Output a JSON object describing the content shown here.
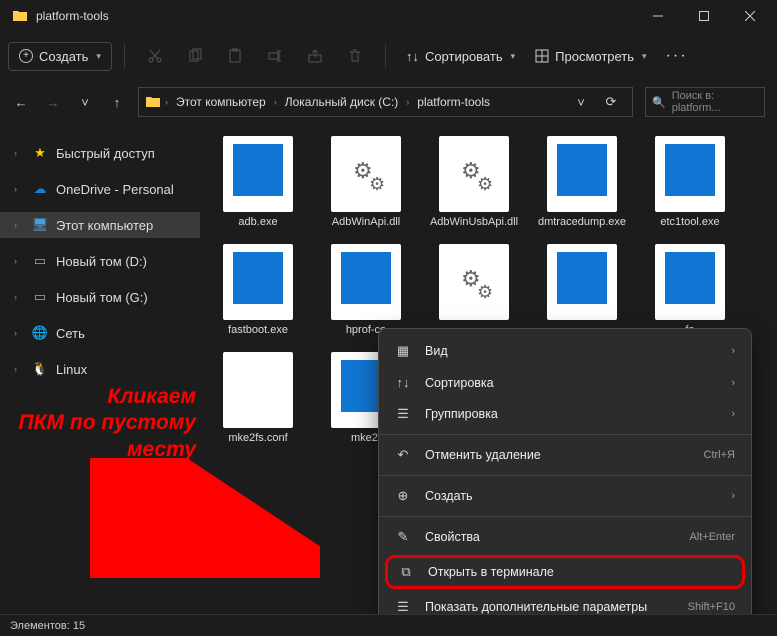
{
  "window": {
    "title": "platform-tools"
  },
  "toolbar": {
    "new_label": "Создать",
    "sort_label": "Сортировать",
    "view_label": "Просмотреть"
  },
  "breadcrumbs": [
    "Этот компьютер",
    "Локальный диск (C:)",
    "platform-tools"
  ],
  "search": {
    "placeholder": "Поиск в: platform..."
  },
  "sidebar": {
    "quick": "Быстрый доступ",
    "onedrive": "OneDrive - Personal",
    "thispc": "Этот компьютер",
    "vold": "Новый том (D:)",
    "volg": "Новый том (G:)",
    "network": "Сеть",
    "linux": "Linux"
  },
  "files": [
    {
      "name": "adb.exe",
      "kind": "exe-blue"
    },
    {
      "name": "AdbWinApi.dll",
      "kind": "dll"
    },
    {
      "name": "AdbWinUsbApi.dll",
      "kind": "dll"
    },
    {
      "name": "dmtracedump.exe",
      "kind": "exe-blue"
    },
    {
      "name": "etc1tool.exe",
      "kind": "exe-blue"
    },
    {
      "name": "fastboot.exe",
      "kind": "exe-blue"
    },
    {
      "name": "hprof-co",
      "kind": "exe-blue"
    },
    {
      "name": "",
      "kind": "dll"
    },
    {
      "name": "",
      "kind": "exe-blue"
    },
    {
      "name": "fo",
      "kind": "exe-blue"
    },
    {
      "name": "mke2fs.conf",
      "kind": "blank"
    },
    {
      "name": "mke2f",
      "kind": "exe-blue"
    },
    {
      "name": "",
      "kind": "exe-blue"
    },
    {
      "name": "",
      "kind": "exe-blue"
    },
    {
      "name": "",
      "kind": "exe-blue"
    }
  ],
  "context_menu": {
    "view": "Вид",
    "sort": "Сортировка",
    "group": "Группировка",
    "undo": "Отменить удаление",
    "undo_hint": "Ctrl+Я",
    "create": "Создать",
    "properties": "Свойства",
    "properties_hint": "Alt+Enter",
    "terminal": "Открыть в терминале",
    "more": "Показать дополнительные параметры",
    "more_hint": "Shift+F10"
  },
  "annotation": {
    "line1": "Кликаем",
    "line2": "ПКМ по пустому",
    "line3": "месту"
  },
  "status": {
    "label": "Элементов: 15"
  }
}
